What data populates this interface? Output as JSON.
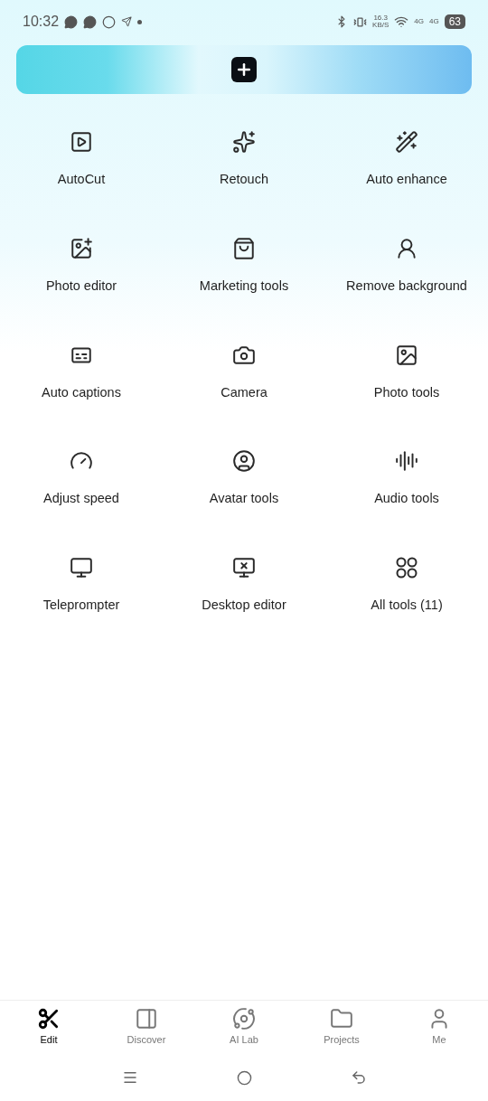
{
  "status_bar": {
    "time": "10:32",
    "net_speed": "16.3",
    "net_unit": "KB/S",
    "network_1": "4G",
    "network_2": "4G",
    "battery": "63"
  },
  "tools": [
    {
      "label": "AutoCut"
    },
    {
      "label": "Retouch"
    },
    {
      "label": "Auto enhance"
    },
    {
      "label": "Photo editor"
    },
    {
      "label": "Marketing tools"
    },
    {
      "label": "Remove background"
    },
    {
      "label": "Auto captions"
    },
    {
      "label": "Camera"
    },
    {
      "label": "Photo tools"
    },
    {
      "label": "Adjust speed"
    },
    {
      "label": "Avatar tools"
    },
    {
      "label": "Audio tools"
    },
    {
      "label": "Teleprompter"
    },
    {
      "label": "Desktop editor"
    },
    {
      "label": "All tools (11)"
    }
  ],
  "bottom_nav": [
    {
      "label": "Edit",
      "selected": true
    },
    {
      "label": "Discover",
      "selected": false
    },
    {
      "label": "AI Lab",
      "selected": false
    },
    {
      "label": "Projects",
      "selected": false
    },
    {
      "label": "Me",
      "selected": false
    }
  ]
}
